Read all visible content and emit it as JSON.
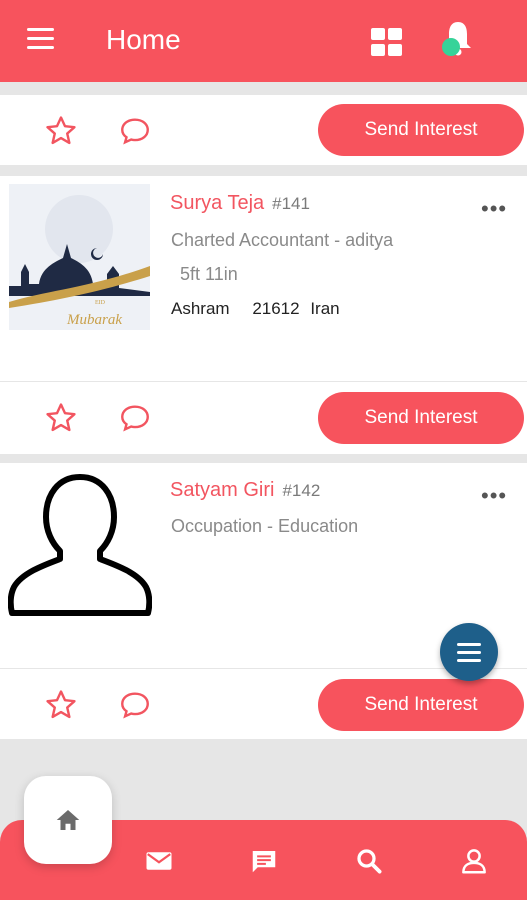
{
  "header": {
    "title": "Home",
    "menu_icon": "hamburger-icon",
    "grid_icon": "grid-icon",
    "bell_icon": "bell-icon"
  },
  "profiles": [
    {
      "name": "Surya Teja",
      "id": "#141",
      "occupation": "Charted Accountant - aditya",
      "height": "5ft 11in",
      "caste": "Ashram",
      "pincode": "21612",
      "country": "Iran",
      "photo": "eid-mubarak-image",
      "image_text": "Mubarak",
      "image_text_small": "EID"
    },
    {
      "name": "Satyam Giri",
      "id": "#142",
      "occupation": "Occupation - Education",
      "photo": "user-silhouette-icon"
    }
  ],
  "actions": {
    "send_interest_label": "Send Interest"
  },
  "bottom_nav": [
    "home-icon",
    "mail-icon",
    "chat-icon",
    "search-icon",
    "profile-icon"
  ],
  "colors": {
    "accent": "#f7535d",
    "fab": "#1e5f8a"
  }
}
